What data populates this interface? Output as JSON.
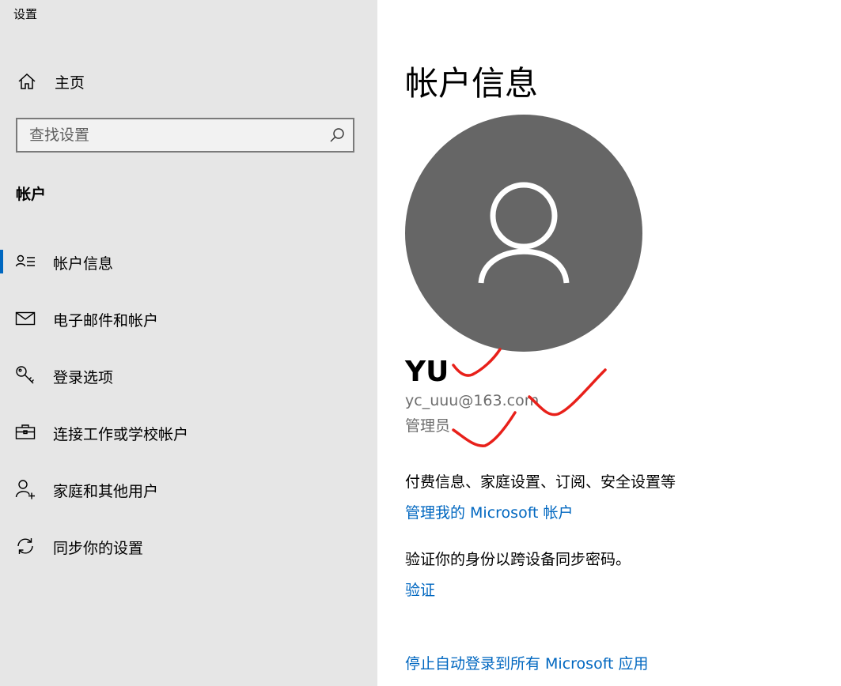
{
  "window": {
    "title": "设置"
  },
  "sidebar": {
    "home_label": "主页",
    "search": {
      "placeholder": "查找设置"
    },
    "section_heading": "帐户",
    "items": [
      {
        "label": "帐户信息",
        "icon": "account-info-icon",
        "selected": true
      },
      {
        "label": "电子邮件和帐户",
        "icon": "mail-icon",
        "selected": false
      },
      {
        "label": "登录选项",
        "icon": "key-icon",
        "selected": false
      },
      {
        "label": "连接工作或学校帐户",
        "icon": "briefcase-icon",
        "selected": false
      },
      {
        "label": "家庭和其他用户",
        "icon": "add-person-icon",
        "selected": false
      },
      {
        "label": "同步你的设置",
        "icon": "sync-icon",
        "selected": false
      }
    ]
  },
  "main": {
    "title": "帐户信息",
    "user": {
      "name": "YU",
      "email": "yc_uuu@163.com",
      "role": "管理员"
    },
    "billing_text": "付费信息、家庭设置、订阅、安全设置等",
    "manage_link": "管理我的 Microsoft 帐户",
    "verify_text": "验证你的身份以跨设备同步密码。",
    "verify_link": "验证",
    "stop_signin_link": "停止自动登录到所有 Microsoft 应用"
  },
  "colors": {
    "sidebar_bg": "#e6e6e6",
    "accent": "#0067c0",
    "avatar_bg": "#666666",
    "annotation_red": "#e8201a"
  }
}
